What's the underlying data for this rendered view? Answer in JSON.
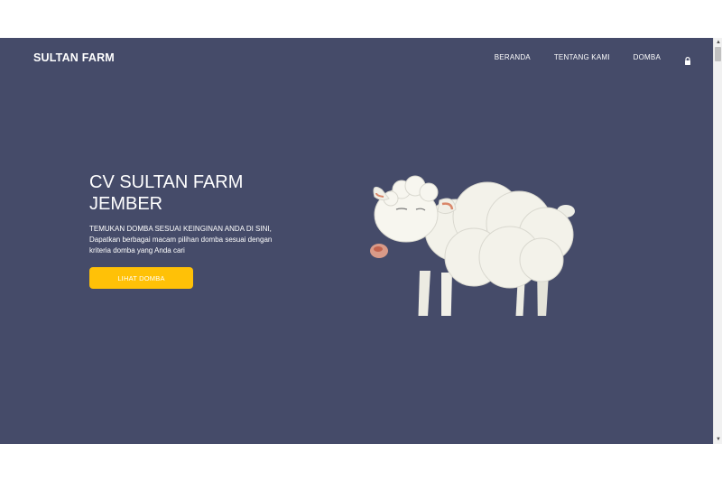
{
  "navbar": {
    "brand": "SULTAN FARM",
    "links": [
      {
        "label": "BERANDA"
      },
      {
        "label": "TENTANG KAMI"
      },
      {
        "label": "DOMBA"
      }
    ],
    "login_icon": "lock-icon"
  },
  "hero": {
    "title": "CV SULTAN FARM JEMBER",
    "subtitle_line1": "TEMUKAN DOMBA SESUAI KEINGINAN ANDA DI SINI,",
    "subtitle_line2": "Dapatkan berbagai macam pilihan domba sesuai dengan kriteria domba yang Anda cari",
    "cta_label": "LIHAT DOMBA",
    "image_icon": "sheep-illustration"
  },
  "colors": {
    "background": "#454b69",
    "accent": "#ffc107",
    "text": "#ffffff"
  }
}
